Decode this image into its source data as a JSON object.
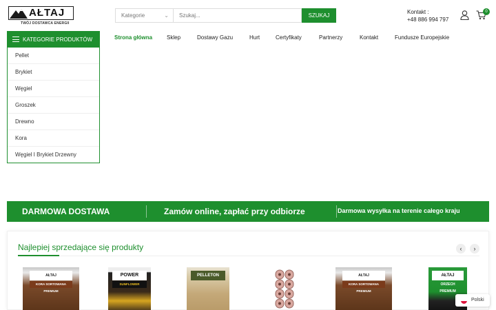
{
  "header": {
    "brand": "AŁTAJ",
    "tagline": "TWÓJ DOSTAWCA ENERGII",
    "search": {
      "category_label": "Kategorie",
      "placeholder": "Szukaj...",
      "button_label": "SZUKAJ"
    },
    "contact": {
      "label": "Kontakt :",
      "phone": "+48 886 994 797"
    },
    "cart_count": "0",
    "icons": [
      "user-icon",
      "cart-icon"
    ]
  },
  "category_menu": {
    "title": "KATEGORIE PRODUKTÓW",
    "items": [
      "Pellet",
      "Brykiet",
      "Węgiel",
      "Groszek",
      "Drewno",
      "Kora",
      "Węgiel I Brykiet Drzewny"
    ]
  },
  "main_nav": {
    "items": [
      "Strona główna",
      "Sklep",
      "Dostawy Gazu",
      "Hurt",
      "Certyfikaty",
      "Partnerzy",
      "Kontakt",
      "Fundusze Europejskie"
    ],
    "active": "Strona główna"
  },
  "banner": {
    "left": "DARMOWA DOSTAWA",
    "center": "Zamów online, zapłać przy odbiorze",
    "right": "Darmowa wysyłka na terenie całego kraju"
  },
  "bestsellers": {
    "title": "Najlepiej sprzedające się produkty",
    "products": [
      {
        "label": "AŁTAJ",
        "sub": "KORA SORTOWANA PREMIUM"
      },
      {
        "label": "POWER",
        "sub": "SUNFLOWER"
      },
      {
        "label": "PELLETON",
        "sub": ""
      },
      {
        "label": "",
        "sub": ""
      },
      {
        "label": "AŁTAJ",
        "sub": "KORA SORTOWANA PREMIUM"
      },
      {
        "label": "AŁTAJ",
        "sub": "ORZECH PREMIUM"
      }
    ]
  },
  "language": {
    "label": "Polski"
  },
  "colors": {
    "accent": "#1e8f2e"
  }
}
